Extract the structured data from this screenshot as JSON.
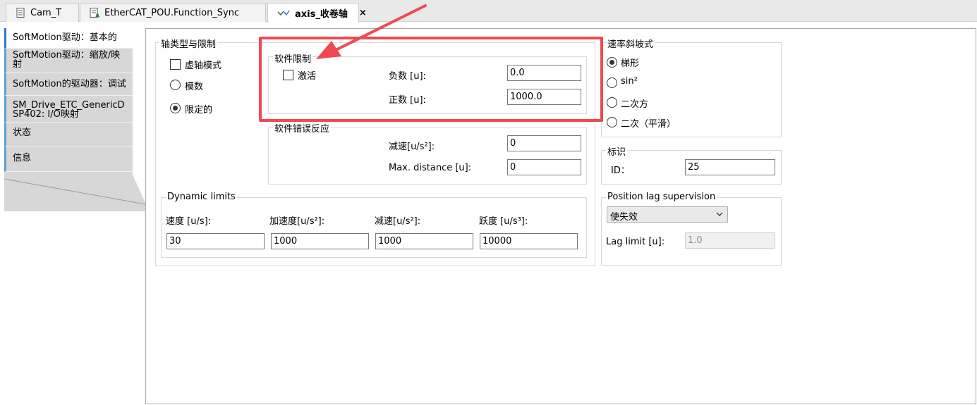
{
  "tabs": [
    {
      "label": "Cam_T",
      "icon": "document-icon",
      "active": false
    },
    {
      "label": "EtherCAT_POU.Function_Sync",
      "icon": "program-icon",
      "active": false
    },
    {
      "label": "axis_收卷轴",
      "icon": "axis-icon",
      "active": true,
      "close": "×"
    }
  ],
  "nav": {
    "items": [
      {
        "label": "SoftMotion驱动：基本的"
      },
      {
        "label": "SoftMotion驱动：缩放/映射"
      },
      {
        "label": "SoftMotion的驱动器：调试"
      },
      {
        "label": "SM_Drive_ETC_GenericDSP402: I/O映射"
      },
      {
        "label": "状态"
      },
      {
        "label": "信息"
      }
    ]
  },
  "axis_type": {
    "title": "轴类型与限制",
    "virtual_label": "虚轴模式",
    "virtual_checked": false,
    "modulo_label": "模数",
    "finite_label": "限定的",
    "selected": "finite"
  },
  "soft_limits": {
    "title": "软件限制",
    "activate_label": "激活",
    "activate_checked": false,
    "negative_label": "负数 [u]:",
    "negative_value": "0.0",
    "positive_label": "正数 [u]:",
    "positive_value": "1000.0"
  },
  "soft_error": {
    "title": "软件错误反应",
    "decel_label": "减速[u/s²]:",
    "decel_value": "0",
    "maxdist_label": "Max. distance [u]:",
    "maxdist_value": "0"
  },
  "dynamic": {
    "title": "Dynamic limits",
    "velocity_label": "速度 [u/s]:",
    "velocity_value": "30",
    "accel_label": "加速度[u/s²]:",
    "accel_value": "1000",
    "decel_label": "减速[u/s²]:",
    "decel_value": "1000",
    "jerk_label": "跃度 [u/s³]:",
    "jerk_value": "10000"
  },
  "ramp": {
    "title": "速率斜坡式",
    "options": [
      "梯形",
      "sin²",
      "二次方",
      "二次（平滑）"
    ],
    "selected_index": 0
  },
  "ident": {
    "title": "标识",
    "id_label": "ID：",
    "id_value": "25"
  },
  "lag": {
    "title": "Position lag supervision",
    "mode_value": "使失效",
    "limit_label": "Lag limit [u]:",
    "limit_value": "1.0"
  },
  "colors": {
    "highlight": "#ef4a52",
    "nav_accent": "#5aa0d8"
  }
}
